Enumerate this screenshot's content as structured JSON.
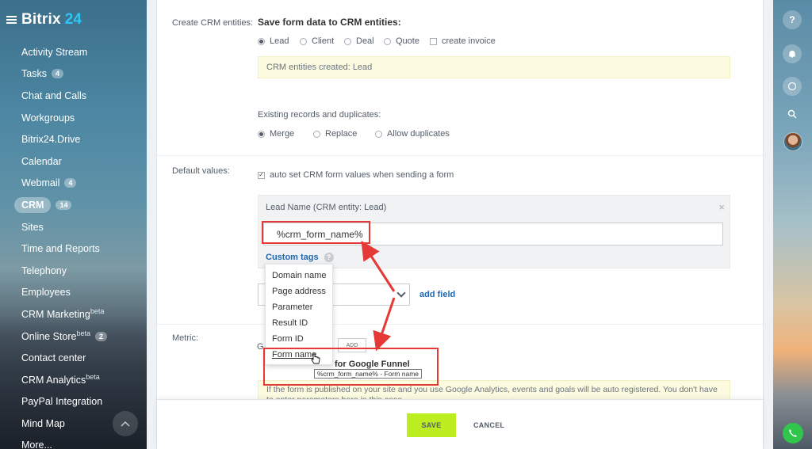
{
  "brand": {
    "name": "Bitrix",
    "number": "24",
    "accent": "#2fc6f6"
  },
  "sidebar": {
    "items": [
      {
        "label": "Activity Stream"
      },
      {
        "label": "Tasks",
        "counter": "4"
      },
      {
        "label": "Chat and Calls"
      },
      {
        "label": "Workgroups"
      },
      {
        "label": "Bitrix24.Drive"
      },
      {
        "label": "Calendar"
      },
      {
        "label": "Webmail",
        "counter": "4"
      },
      {
        "label": "CRM",
        "counter": "14",
        "active": true
      },
      {
        "label": "Sites"
      },
      {
        "label": "Time and Reports"
      },
      {
        "label": "Telephony"
      },
      {
        "label": "Employees"
      },
      {
        "label": "CRM Marketing",
        "sup": "beta"
      },
      {
        "label": "Online Store",
        "sup": "beta",
        "counter": "2"
      },
      {
        "label": "Contact center"
      },
      {
        "label": "CRM Analytics",
        "sup": "beta"
      },
      {
        "label": "PayPal Integration"
      },
      {
        "label": "Mind Map"
      },
      {
        "label": "More..."
      }
    ]
  },
  "rightbar": {
    "icons": [
      "help-icon",
      "bell-icon",
      "chat-icon",
      "search-icon",
      "avatar",
      "phone-icon"
    ]
  },
  "form": {
    "create_label": "Create CRM entities:",
    "section_title": "Save form data to CRM entities:",
    "entities": [
      {
        "label": "Lead",
        "selected": true
      },
      {
        "label": "Client",
        "selected": false
      },
      {
        "label": "Deal",
        "selected": false
      },
      {
        "label": "Quote",
        "selected": false
      }
    ],
    "invoice_label": "create invoice",
    "created_note": "CRM entities created: Lead",
    "duplicates_label": "Existing records and duplicates:",
    "duplicates": [
      {
        "label": "Merge",
        "selected": true
      },
      {
        "label": "Replace",
        "selected": false
      },
      {
        "label": "Allow duplicates",
        "selected": false
      }
    ],
    "default_values_label": "Default values:",
    "auto_set_label": "auto set CRM form values when sending a form",
    "lead_box_title": "Lead Name (CRM entity: Lead)",
    "lead_input_value": "%crm_form_name%",
    "custom_tags_label": "Custom tags",
    "custom_tags": [
      "Domain name",
      "Page address",
      "Parameter",
      "Result ID",
      "Form ID",
      "Form name"
    ],
    "tooltip": "%crm_form_name% - Form name",
    "add_field_label": "add field",
    "metric_label": "Metric:",
    "metric_partial": "G",
    "add_button": "ADD",
    "funnel_label": "for Google Funnel",
    "ga_note": "If the form is published on your site and you use Google Analytics, events and goals will be auto registered. You don't have to enter parameters here in this case."
  },
  "footer": {
    "save": "SAVE",
    "cancel": "CANCEL"
  },
  "colors": {
    "annotation_red": "#e53935",
    "save_green": "#bbed21",
    "link_blue": "#2067b0"
  }
}
